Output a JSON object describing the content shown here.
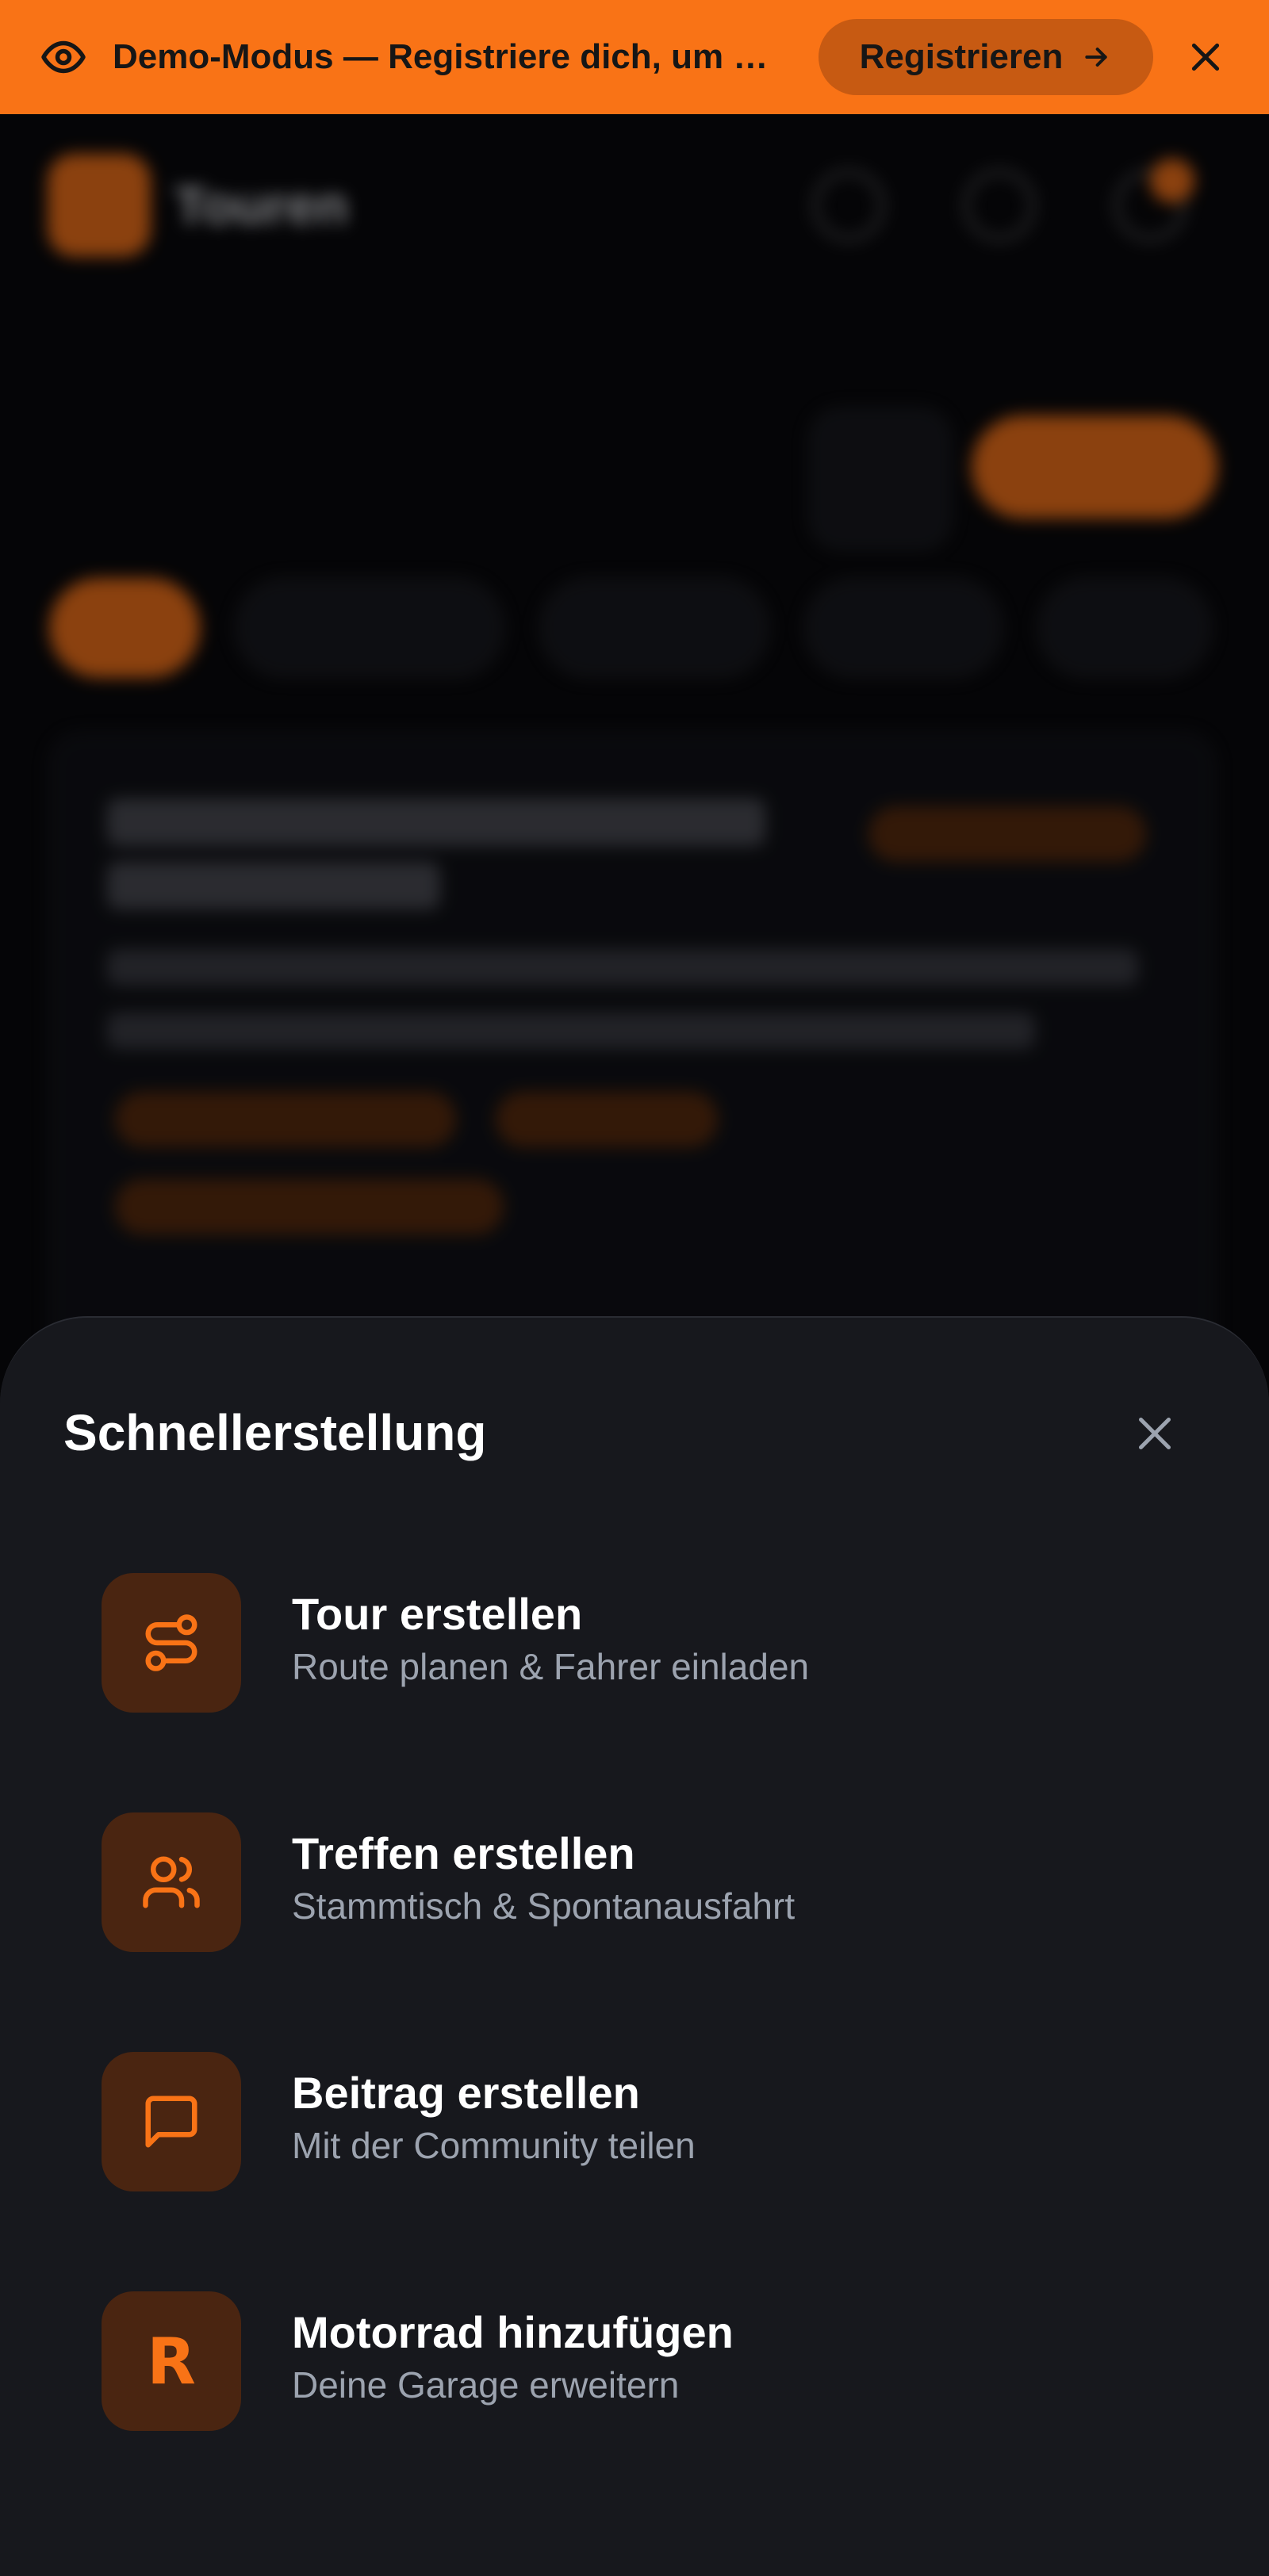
{
  "banner": {
    "text": "Demo-Modus — Registriere dich, um alle Funktionen zu nutzen",
    "register_label": "Registrieren",
    "icons": {
      "eye": "eye-icon",
      "arrow": "arrow-right-icon",
      "close": "close-icon"
    }
  },
  "background": {
    "app_title": "Touren"
  },
  "sheet": {
    "title": "Schnellerstellung",
    "items": [
      {
        "title": "Tour erstellen",
        "subtitle": "Route planen & Fahrer einladen",
        "icon": "route-icon"
      },
      {
        "title": "Treffen erstellen",
        "subtitle": "Stammtisch & Spontanausfahrt",
        "icon": "users-icon"
      },
      {
        "title": "Beitrag erstellen",
        "subtitle": "Mit der Community teilen",
        "icon": "message-square-icon"
      },
      {
        "title": "Motorrad hinzufügen",
        "subtitle": "Deine Garage erweitern",
        "icon": "motorcycle-letter-icon",
        "letter": "R"
      }
    ]
  },
  "colors": {
    "accent": "#f97316",
    "sheet_bg": "#17181d",
    "icon_tile_bg": "#4a2511",
    "subtitle": "#9ca3af"
  }
}
